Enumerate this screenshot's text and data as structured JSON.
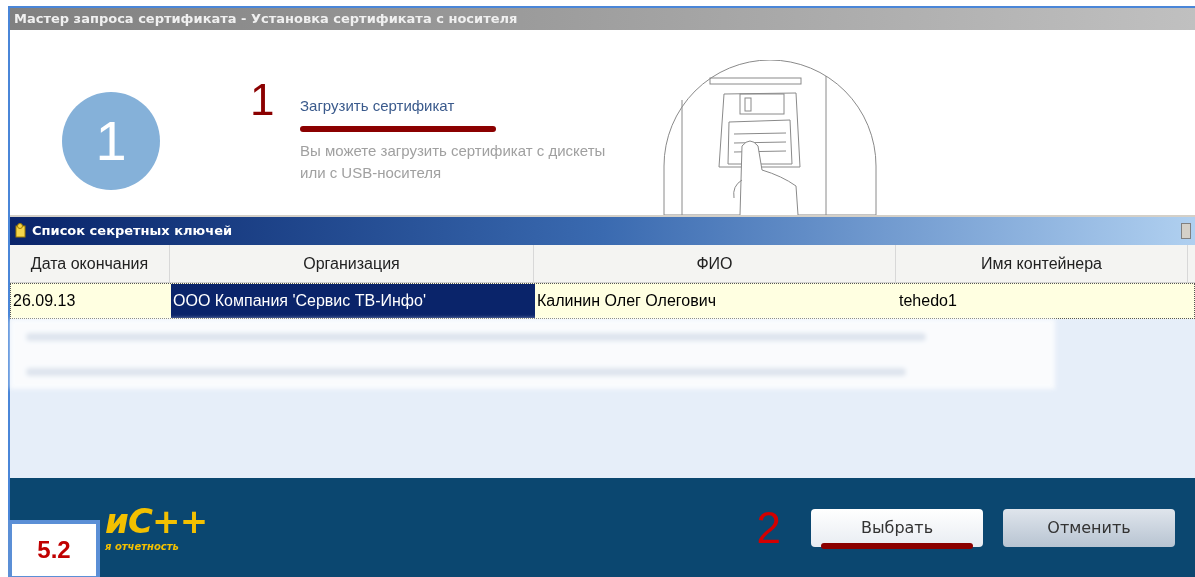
{
  "window": {
    "title": "Мастер запроса сертификата - Установка сертификата с носителя"
  },
  "step": {
    "number": "1",
    "annotation": "1",
    "link": "Загрузить сертификат",
    "description": "Вы можете загрузить сертификат с дискеты или с USB-носителя"
  },
  "dialog": {
    "title": "Список секретных ключей",
    "columns": [
      "Дата окончания",
      "Организация",
      "ФИО",
      "Имя контейнера"
    ],
    "rows": [
      {
        "selected": true,
        "cells": [
          {
            "text": "26.09.13",
            "focused": false
          },
          {
            "text": "ООО Компания 'Сервис ТВ-Инфо'",
            "focused": true
          },
          {
            "text": "Калинин Олег Олегович",
            "focused": false
          },
          {
            "text": "tehedo1",
            "focused": false
          }
        ]
      }
    ]
  },
  "footer": {
    "logo": {
      "mark": "иС++",
      "tagline": "я отчетность"
    },
    "annotation": "2",
    "buttons": [
      {
        "label": "Выбрать",
        "kind": "primary"
      },
      {
        "label": "Отменить",
        "kind": "secondary"
      }
    ],
    "badge": "5.2"
  }
}
